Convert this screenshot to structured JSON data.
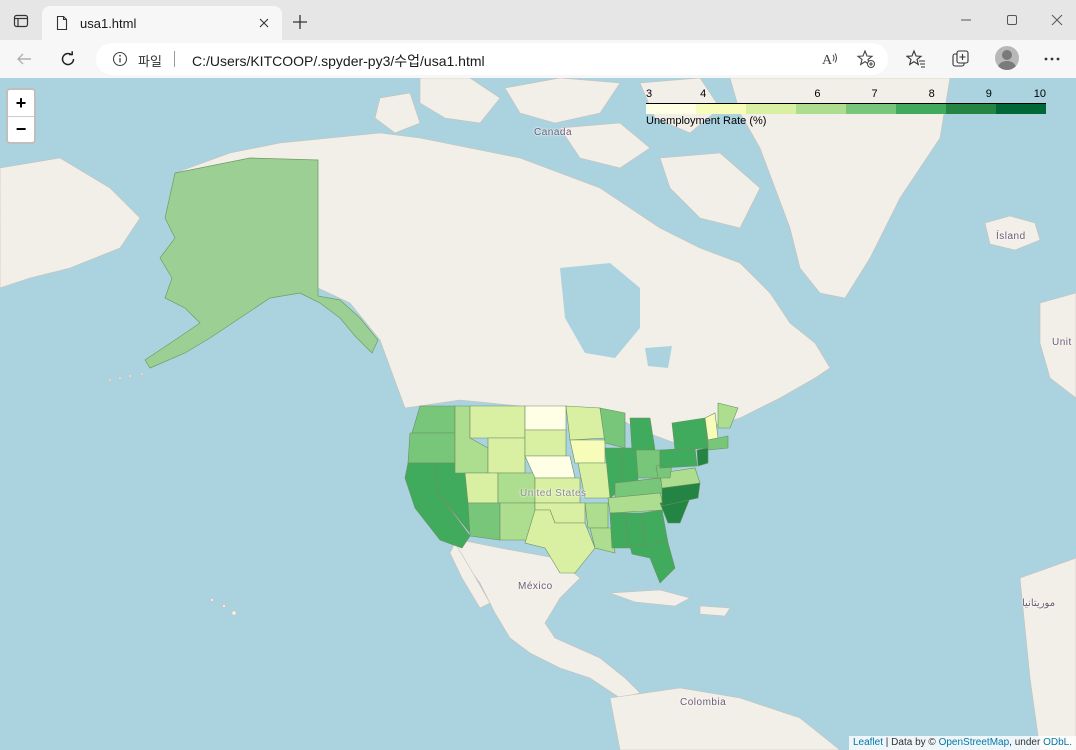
{
  "tab": {
    "title": "usa1.html"
  },
  "address": {
    "site_label": "파일",
    "url": "C:/Users/KITCOOP/.spyder-py3/수업/usa1.html"
  },
  "icons": {
    "tab_actions": "tab-actions-icon",
    "file": "file-icon",
    "close": "close-icon",
    "new_tab": "plus-icon",
    "back": "back-arrow-icon",
    "refresh": "refresh-icon",
    "info": "info-icon",
    "read_aloud": "read-aloud-icon",
    "add_favorite": "star-plus-icon",
    "favorites": "favorites-icon",
    "collections": "collections-icon",
    "profile": "profile-avatar",
    "more": "more-icon"
  },
  "map": {
    "zoom_in": "+",
    "zoom_out": "−",
    "labels": {
      "canada": "Canada",
      "island": "Ísland",
      "unit": "Unit",
      "united_states": "United States",
      "mexico": "México",
      "colombia": "Colombia",
      "mauritania": "موريتانيا"
    },
    "legend": {
      "caption": "Unemployment Rate (%)",
      "ticks": [
        "3",
        "4",
        "6",
        "7",
        "8",
        "9",
        "10"
      ],
      "tick_values": [
        3,
        4,
        6,
        7,
        8,
        9,
        10
      ],
      "colors": [
        "#ffffe5",
        "#f7fcb9",
        "#d9f0a3",
        "#addd8e",
        "#78c679",
        "#41ab5d",
        "#238443",
        "#006837"
      ]
    },
    "attribution": {
      "leaflet": "Leaflet",
      "data_by": " | Data by © ",
      "osm": "OpenStreetMap",
      "under": ", under ",
      "odbl": "ODbL."
    }
  },
  "colors": {
    "ocean": "#aad3df",
    "land": "#f2efe9",
    "alaska_fill": "#9ccf94"
  }
}
